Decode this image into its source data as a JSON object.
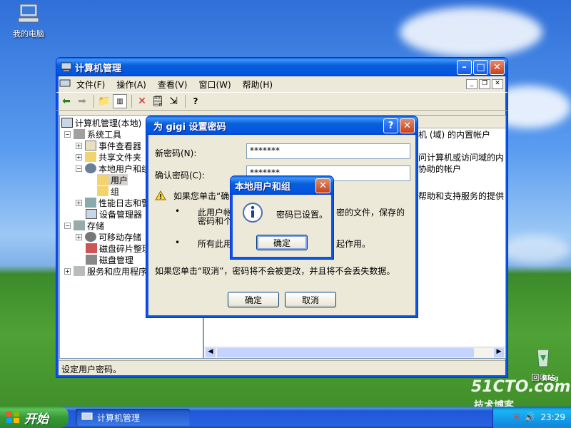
{
  "desktop": {
    "my_computer": "我的电脑",
    "recycle_bin": "回收站",
    "watermark_main": "51CTO.com",
    "watermark_sub": "技术博客",
    "watermark_blog": "Blog"
  },
  "main_window": {
    "title": "计算机管理",
    "menu": [
      "文件(F)",
      "操作(A)",
      "查看(V)",
      "窗口(W)",
      "帮助(H)"
    ],
    "tree": [
      "计算机管理(本地)",
      "系统工具",
      "事件查看器",
      "共享文件夹",
      "本地用户和组",
      "用户",
      "组",
      "性能日志和警",
      "设备管理器",
      "存储",
      "可移动存储",
      "磁盘碎片整理",
      "磁盘管理",
      "服务和应用程序"
    ],
    "right_pane_lines": [
      "机 (域) 的内置帐户",
      "问计算机或访问域的内",
      "协助的帐户",
      "帮助和支持服务的提供"
    ],
    "status": "设定用户密码。"
  },
  "password_dialog": {
    "title": "为 gigi 设置密码",
    "new_password_label": "新密码(N):",
    "confirm_password_label": "确认密码(C):",
    "new_password_value": "*******",
    "confirm_password_value": "*******",
    "warning_lead": "如果您单击“确",
    "bullet1_a": "此用户帐",
    "bullet1_b": "密码和个",
    "bullet1_c": "密的文件，保存的",
    "bullet2_a": "所有此用",
    "bullet2_b": "起作用。",
    "cancel_note": "如果您单击“取消”，密码将不会被更改，并且将不会丢失数据。",
    "ok_label": "确定",
    "cancel_label": "取消"
  },
  "message_box": {
    "title": "本地用户和组",
    "message": "密码已设置。",
    "ok_label": "确定"
  },
  "taskbar": {
    "start_label": "开始",
    "task_label": "计算机管理",
    "clock": "23:29"
  }
}
